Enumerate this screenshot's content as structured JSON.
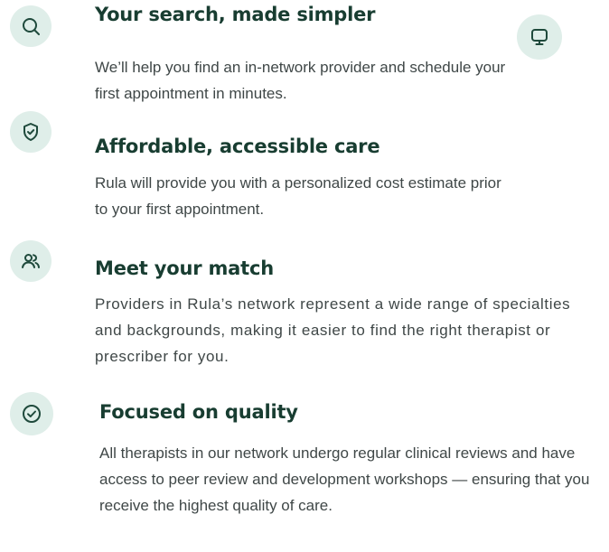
{
  "features": [
    {
      "icon": "search-icon",
      "title": "Your search, made simpler",
      "body": "We’ll help you find an in-network provider and schedule your first appointment in minutes."
    },
    {
      "icon": "shield-check-icon",
      "title": "Affordable, accessible care",
      "body": "Rula will provide you with a personalized cost estimate prior to your first appointment."
    },
    {
      "icon": "users-icon",
      "title": "Meet your match",
      "body": "Providers in Rula’s network represent a wide range of specialties and backgrounds, making it easier to find the right therapist or prescriber for you."
    },
    {
      "icon": "check-circle-icon",
      "title": "Focused on quality",
      "body": "All therapists in our network undergo regular clinical reviews and have access to peer review and development workshops — ensuring that you receive the highest quality of care."
    }
  ],
  "extra_icon": "monitor-icon",
  "colors": {
    "icon_bg": "#dfeee9",
    "icon_stroke": "#1f4a3c",
    "heading": "#183d31",
    "body": "#3f4747"
  }
}
